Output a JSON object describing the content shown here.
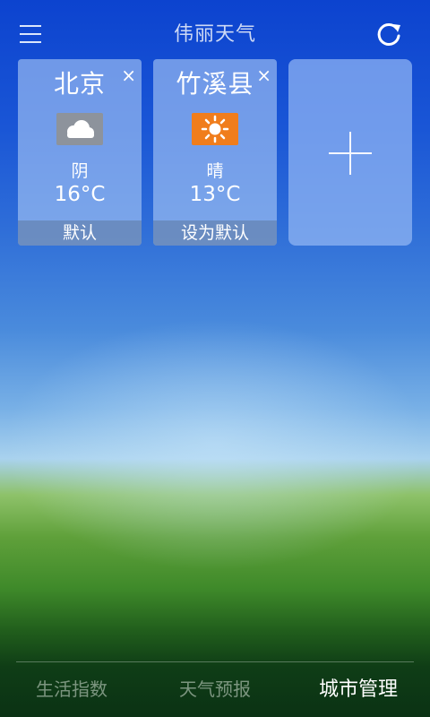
{
  "header": {
    "title": "伟丽天气",
    "menu_icon": "hamburger-menu-icon",
    "refresh_icon": "refresh-icon"
  },
  "cities": [
    {
      "name": "北京",
      "close_label": "×",
      "icon": "cloudy-icon",
      "condition": "阴",
      "temperature": "16°C",
      "footer_label": "默认"
    },
    {
      "name": "竹溪县",
      "close_label": "×",
      "icon": "sunny-icon",
      "condition": "晴",
      "temperature": "13°C",
      "footer_label": "设为默认"
    }
  ],
  "add_card": {
    "icon": "plus-icon"
  },
  "bottom_nav": {
    "tabs": [
      {
        "label": "生活指数",
        "active": false
      },
      {
        "label": "天气预报",
        "active": false
      },
      {
        "label": "城市管理",
        "active": true
      }
    ]
  },
  "colors": {
    "sky_top": "#0c43cf",
    "grass": "#3f8a2a",
    "sunny_icon_bg": "#f07d1c",
    "cloudy_icon_bg": "#8d939c"
  }
}
